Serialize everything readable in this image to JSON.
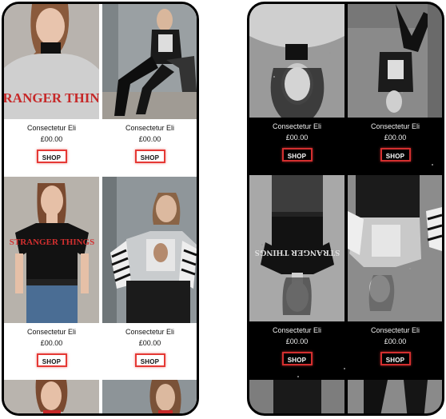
{
  "light_screen": {
    "products": [
      {
        "name": "Consectetur Eli",
        "price": "£00.00",
        "button": "SHOP",
        "print_text": "STRANGER THINGS"
      },
      {
        "name": "Consectetur Eli",
        "price": "£00.00",
        "button": "SHOP",
        "print_text": ""
      },
      {
        "name": "Consectetur Eli",
        "price": "£00.00",
        "button": "SHOP",
        "print_text": "STRANGER THINGS"
      },
      {
        "name": "Consectetur Eli",
        "price": "£00.00",
        "button": "SHOP",
        "print_text": ""
      }
    ]
  },
  "dark_screen": {
    "products": [
      {
        "name": "Consectetur Eli",
        "price": "£00.00",
        "button": "SHOP",
        "print_text": ""
      },
      {
        "name": "Consectetur Eli",
        "price": "£00.00",
        "button": "SHOP",
        "print_text": ""
      },
      {
        "name": "Consectetur Eli",
        "price": "£00.00",
        "button": "SHOP",
        "print_text": "STRANGER THINGS"
      },
      {
        "name": "Consectetur Eli",
        "price": "£00.00",
        "button": "SHOP",
        "print_text": ""
      }
    ]
  },
  "colors": {
    "accent_red": "#e53935",
    "light_bg": "#ffffff",
    "dark_bg": "#000000"
  }
}
